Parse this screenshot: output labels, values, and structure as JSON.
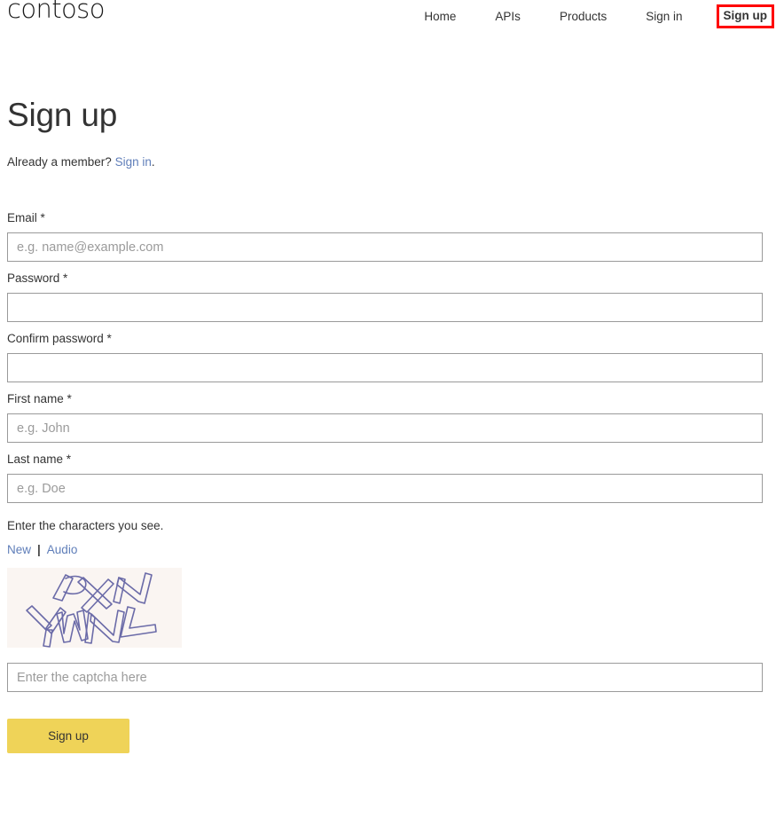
{
  "header": {
    "brand": "contoso",
    "nav": [
      {
        "label": "Home",
        "highlighted": false
      },
      {
        "label": "APIs",
        "highlighted": false
      },
      {
        "label": "Products",
        "highlighted": false
      },
      {
        "label": "Sign in",
        "highlighted": false
      },
      {
        "label": "Sign up",
        "highlighted": true
      }
    ],
    "highlight_color": "#ff0000"
  },
  "main": {
    "page_title": "Sign up",
    "member_prefix": "Already a member? ",
    "member_link": "Sign in",
    "member_suffix": "."
  },
  "form": {
    "fields": [
      {
        "label": "Email *",
        "placeholder": "e.g. name@example.com",
        "value": "",
        "type": "email"
      },
      {
        "label": "Password *",
        "placeholder": "",
        "value": "",
        "type": "password"
      },
      {
        "label": "Confirm password *",
        "placeholder": "",
        "value": "",
        "type": "password"
      },
      {
        "label": "First name *",
        "placeholder": "e.g. John",
        "value": "",
        "type": "text"
      },
      {
        "label": "Last name *",
        "placeholder": "e.g. Doe",
        "value": "",
        "type": "text"
      }
    ]
  },
  "captcha": {
    "prompt": "Enter the characters you see.",
    "new_link": "New",
    "separator": "|",
    "audio_link": "Audio",
    "image_text": "PXNYWNL",
    "image_background": "#faf5f2",
    "image_stroke": "#6b6ba8",
    "input_placeholder": "Enter the captcha here",
    "input_value": ""
  },
  "submit": {
    "label": "Sign up",
    "color": "#efd358"
  }
}
